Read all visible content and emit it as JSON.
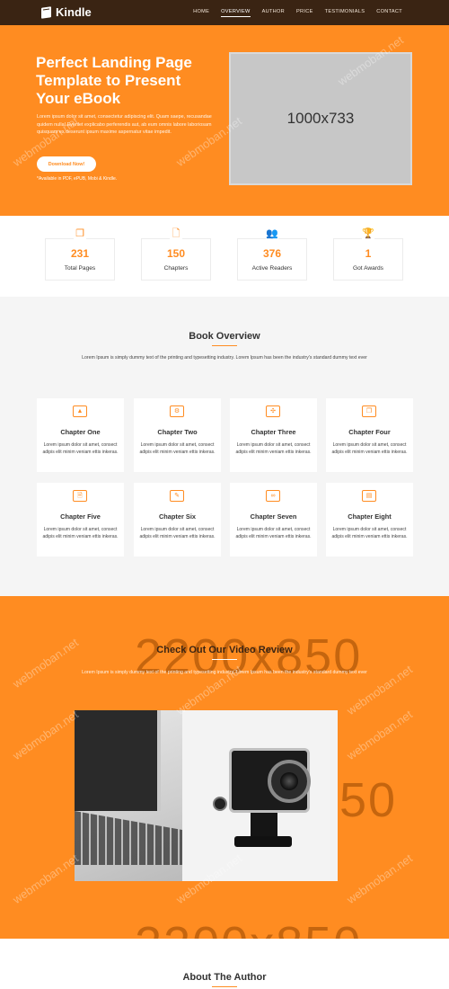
{
  "header": {
    "brand": "Kindle",
    "nav": [
      "HOME",
      "OVERVIEW",
      "AUTHOR",
      "PRICE",
      "TESTIMONIALS",
      "CONTACT"
    ]
  },
  "hero": {
    "title": "Perfect Landing Page Template to Present Your eBook",
    "text": "Lorem ipsum dolor sit amet, consectetur adipiscing elit. Quam saepe, recusandae quidem nulla! Eveniet explicabo perferendis aut, ab eum omnis labore laboriosam quisquam ex deserunt ipsum maxime aspernatur vitae impedit.",
    "button": "Download Now!",
    "note": "*Available in PDF, ePUB, Mobi & Kindle.",
    "image_label": "1000x733"
  },
  "stats": [
    {
      "icon": "copy-icon",
      "value": "231",
      "label": "Total Pages"
    },
    {
      "icon": "file-icon",
      "value": "150",
      "label": "Chapters"
    },
    {
      "icon": "users-icon",
      "value": "376",
      "label": "Active Readers"
    },
    {
      "icon": "trophy-icon",
      "value": "1",
      "label": "Got Awards"
    }
  ],
  "overview": {
    "title": "Book Overview",
    "subtitle": "Lorem Ipsum is simply dummy text of the printing and typesetting industry. Lorem Ipsum has been the industry's standard dummy text ever",
    "chapters": [
      {
        "title": "Chapter One",
        "text": "Lorem ipsum dolor sit amet, consect adipis elit minim veniam ettis inkeras."
      },
      {
        "title": "Chapter Two",
        "text": "Lorem ipsum dolor sit amet, consect adipis elit minim veniam ettis inkeras."
      },
      {
        "title": "Chapter Three",
        "text": "Lorem ipsum dolor sit amet, consect adipis elit minim veniam ettis inkeras."
      },
      {
        "title": "Chapter Four",
        "text": "Lorem ipsum dolor sit amet, consect adipis elit minim veniam ettis inkeras."
      },
      {
        "title": "Chapter Five",
        "text": "Lorem ipsum dolor sit amet, consect adipis elit minim veniam ettis inkeras."
      },
      {
        "title": "Chapter Six",
        "text": "Lorem ipsum dolor sit amet, consect adipis elit minim veniam ettis inkeras."
      },
      {
        "title": "Chapter Seven",
        "text": "Lorem ipsum dolor sit amet, consect adipis elit minim veniam ettis inkeras."
      },
      {
        "title": "Chapter Eight",
        "text": "Lorem ipsum dolor sit amet, consect adipis elit minim veniam ettis inkeras."
      }
    ]
  },
  "video": {
    "title": "Check Out Our Video Review",
    "subtitle": "Lorem Ipsum is simply dummy text of the printing and typesetting industry. Lorem Ipsum has been the industry's standard dummy text ever",
    "placeholder": "2200x850",
    "placeholder_fragment": "50"
  },
  "author": {
    "title": "About The Author"
  },
  "watermark": "webmoban.net",
  "colors": {
    "accent": "#ff8c21",
    "header_bg": "#3a2413",
    "section_bg": "#f5f5f5"
  }
}
